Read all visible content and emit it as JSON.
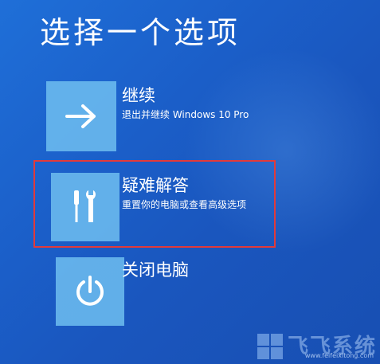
{
  "page": {
    "title": "选择一个选项"
  },
  "options": [
    {
      "title": "继续",
      "description": "退出并继续 Windows 10 Pro",
      "icon": "arrow-right-icon"
    },
    {
      "title": "疑难解答",
      "description": "重置你的电脑或查看高级选项",
      "icon": "tools-icon"
    },
    {
      "title": "关闭电脑",
      "description": "",
      "icon": "power-icon"
    }
  ],
  "watermark": {
    "text": "飞飞系统",
    "url": "www.feifeixitong.com"
  },
  "colors": {
    "background": "#1b5fc9",
    "tile": "#6ebef0",
    "highlight": "#e23a3a"
  }
}
